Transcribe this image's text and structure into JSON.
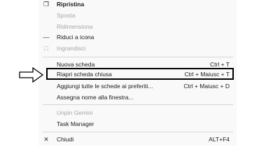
{
  "menu": {
    "items": [
      {
        "label": "Ripristina",
        "icon": "restore-icon",
        "glyph": "❐",
        "shortcut": "",
        "disabled": false,
        "bold": true
      },
      {
        "label": "Sposta",
        "icon": "",
        "glyph": "",
        "shortcut": "",
        "disabled": true,
        "bold": false
      },
      {
        "label": "Ridimensiona",
        "icon": "",
        "glyph": "",
        "shortcut": "",
        "disabled": true,
        "bold": false
      },
      {
        "label": "Riduci a icona",
        "icon": "minimize-icon",
        "glyph": "—",
        "shortcut": "",
        "disabled": false,
        "bold": false
      },
      {
        "label": "Ingrandisci",
        "icon": "maximize-icon",
        "glyph": "□",
        "shortcut": "",
        "disabled": true,
        "bold": false
      },
      {
        "label": "Nuova scheda",
        "icon": "",
        "glyph": "",
        "shortcut": "Ctrl + T",
        "disabled": false,
        "bold": false
      },
      {
        "label": "Riapri scheda chiusa",
        "icon": "",
        "glyph": "",
        "shortcut": "Ctrl + Maiusc + T",
        "disabled": false,
        "bold": false
      },
      {
        "label": "Aggiungi tutte le schede ai preferiti...",
        "icon": "",
        "glyph": "",
        "shortcut": "Ctrl + Maiusc + D",
        "disabled": false,
        "bold": false
      },
      {
        "label": "Assegna nome alla finestra...",
        "icon": "",
        "glyph": "",
        "shortcut": "",
        "disabled": false,
        "bold": false
      },
      {
        "label": "Unpin Gemini",
        "icon": "",
        "glyph": "",
        "shortcut": "",
        "disabled": true,
        "bold": false
      },
      {
        "label": "Task Manager",
        "icon": "",
        "glyph": "",
        "shortcut": "",
        "disabled": false,
        "bold": false
      },
      {
        "label": "Chiudi",
        "icon": "close-icon",
        "glyph": "✕",
        "shortcut": "ALT+F4",
        "disabled": false,
        "bold": false
      }
    ]
  },
  "annotation": {
    "highlighted_item": "Riapri scheda chiusa",
    "arrow_icon": "right-arrow-icon"
  }
}
